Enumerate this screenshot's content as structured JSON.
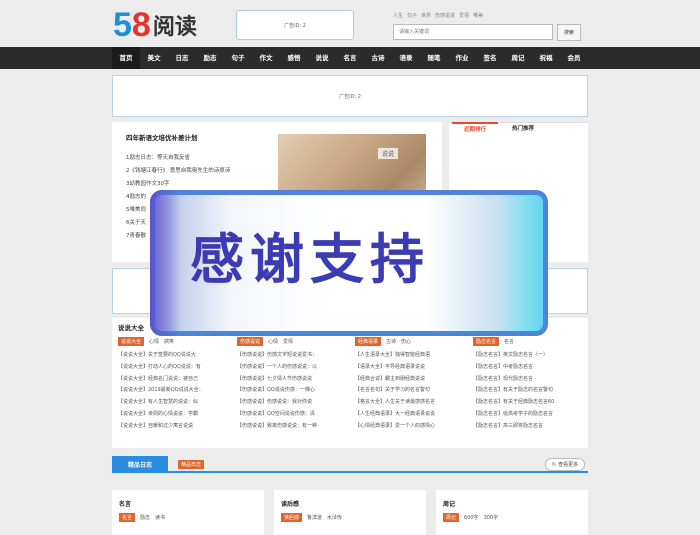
{
  "header": {
    "logo_num5": "5",
    "logo_num8": "8",
    "logo_text": "阅读",
    "ad_label": "广告ID: 2",
    "hotwords": [
      "人生",
      "句子",
      "世界",
      "伤感说说",
      "爱情",
      "唯美"
    ],
    "search_placeholder": "请输入关键词",
    "search_button": "搜索"
  },
  "nav": [
    "首页",
    "美文",
    "日志",
    "励志",
    "句子",
    "作文",
    "感悟",
    "说说",
    "名言",
    "古诗",
    "语录",
    "随笔",
    "作业",
    "签名",
    "周记",
    "祝福",
    "会员"
  ],
  "ad_wide_label": "广告ID: 2",
  "news": {
    "title": "四年新语文培优补差计划",
    "items": [
      "1励志日志：等天自我反省",
      "2《钱塘江春行》 意思自我奥先生的诗原诗",
      "3幼教园作文30字",
      "4励志的",
      "5唯美同",
      "6关于天",
      "7青春散"
    ],
    "photo_tag": "说说"
  },
  "rank": {
    "tab1": "近期排行",
    "tab2": "热门推荐"
  },
  "quotes": {
    "title": "说说大全",
    "columns": [
      {
        "tag": "说说大全",
        "subs": [
          "心情",
          "搞笑"
        ],
        "items": [
          "【说说大全】关于签要的QQ说说大",
          "【说说大全】打动人心的QQ说说：有",
          "【说说大全】经典名门说说：被自己",
          "【说说大全】2019最新QQ说说大全：",
          "【说说大全】有人生智慧的说说：似",
          "【说说大全】幸则的心情说说：学霸",
          "【说说大全】自暖和过少寓言说说"
        ]
      },
      {
        "tag": "伤感说说",
        "subs": [
          "心情",
          "爱情"
        ],
        "items": [
          "【伤感说说】伤感文字短说说爱书：",
          "【伤感说说】一个人的伤感说说：以",
          "【伤感说说】七夕情人节伤感说说",
          "【伤感说说】QQ说说伤感：一棵心",
          "【伤感说说】伤感说说：我对你说",
          "【伤感说说】QQ空间说说伤感：清",
          "【伤感说说】致离伤感说说：有一种"
        ]
      },
      {
        "tag": "经典语录",
        "subs": [
          "古诗",
          "伤心"
        ],
        "items": [
          "【人生语录大全】独得智能经典语",
          "【语录大全】平导经典语录说说",
          "【经典合说】霸主到朋经典说说",
          "【名言名句】关于学习的名言警句",
          "【格言大全】人生关于读最感感名言",
          "【人生经典语录】大一经典语录说说",
          "【心情经典语录】爱一个人的感情心"
        ]
      },
      {
        "tag": "励志名言",
        "subs": [
          "名言"
        ],
        "items": [
          "【励志名言】英文励志名言（一）",
          "【励志名言】中考励志名言",
          "【励志名言】现代励志名言",
          "【励志名言】有关于励志的名言警句",
          "【励志名言】有关于经典励志名言60",
          "【励志名言】给高考学子的励志名言",
          "【励志名言】高三即将励志名言"
        ]
      }
    ]
  },
  "jingpin": {
    "tab": "精品日志",
    "tag": "精品日志",
    "more": "查看更多"
  },
  "cards": [
    {
      "title": "名言",
      "tag": "名言",
      "subs": [
        "励志",
        "读书"
      ]
    },
    {
      "title": "读后感",
      "tag": "读后感",
      "subs": [
        "鲁滨逊",
        "水浒传"
      ]
    },
    {
      "title": "周记",
      "tag": "周记",
      "subs": [
        "600字",
        "300字"
      ]
    }
  ],
  "overlay_text": "感谢支持",
  "colors": {
    "accent_orange": "#e3632e",
    "accent_blue": "#2a8de0",
    "nav_bg": "#2b2b2b"
  }
}
